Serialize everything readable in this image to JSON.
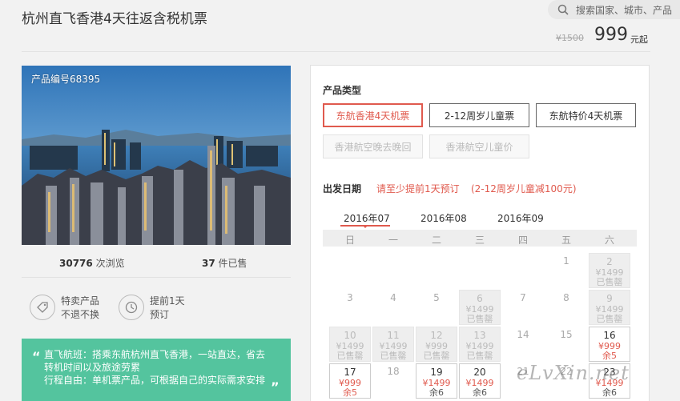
{
  "header": {
    "title": "杭州直飞香港4天往返含税机票",
    "search_placeholder": "搜索国家、城市、产品",
    "old_price": "¥1500",
    "price": "999",
    "price_unit": "元起"
  },
  "product": {
    "number_label": "产品编号68395",
    "views_count": "30776",
    "views_label": "次浏览",
    "sold_count": "37",
    "sold_label": "件已售",
    "features": [
      {
        "icon": "tag-icon",
        "line1": "特卖产品",
        "line2": "不退不换"
      },
      {
        "icon": "clock-icon",
        "line1": "提前1天",
        "line2": "预订"
      }
    ],
    "description": [
      "直飞航班：搭乘东航杭州直飞香港，一站直达，省去",
      "转机时间以及旅途劳累",
      "行程自由：单机票产品，可根据自己的实际需求安排"
    ],
    "quote_open": "“",
    "quote_close": "”"
  },
  "booking": {
    "type_label": "产品类型",
    "types": [
      {
        "label": "东航香港4天机票",
        "state": "active"
      },
      {
        "label": "2-12周岁儿童票",
        "state": "normal"
      },
      {
        "label": "东航特价4天机票",
        "state": "normal"
      },
      {
        "label": "香港航空晚去晚回",
        "state": "disabled"
      },
      {
        "label": "香港航空儿童价",
        "state": "disabled"
      }
    ],
    "date_label": "出发日期",
    "note1": "请至少提前1天预订",
    "note2": "(2-12周岁儿童减100元)",
    "months": [
      "2016年07",
      "2016年08",
      "2016年09"
    ],
    "active_month": "2016年07",
    "weekdays": [
      "日",
      "一",
      "二",
      "三",
      "四",
      "五",
      "六"
    ],
    "days": [
      {
        "n": "1",
        "col": 5,
        "row": 0,
        "state": "plain"
      },
      {
        "n": "2",
        "col": 6,
        "row": 0,
        "state": "soldout",
        "price": "¥1499",
        "status": "已售罄"
      },
      {
        "n": "3",
        "col": 0,
        "row": 1,
        "state": "plain"
      },
      {
        "n": "4",
        "col": 1,
        "row": 1,
        "state": "plain"
      },
      {
        "n": "5",
        "col": 2,
        "row": 1,
        "state": "plain"
      },
      {
        "n": "6",
        "col": 3,
        "row": 1,
        "state": "soldout",
        "price": "¥1499",
        "status": "已售罄"
      },
      {
        "n": "7",
        "col": 4,
        "row": 1,
        "state": "plain"
      },
      {
        "n": "8",
        "col": 5,
        "row": 1,
        "state": "plain"
      },
      {
        "n": "9",
        "col": 6,
        "row": 1,
        "state": "soldout",
        "price": "¥1499",
        "status": "已售罄"
      },
      {
        "n": "10",
        "col": 0,
        "row": 2,
        "state": "soldout",
        "price": "¥1499",
        "status": "已售罄"
      },
      {
        "n": "11",
        "col": 1,
        "row": 2,
        "state": "soldout",
        "price": "¥1499",
        "status": "已售罄"
      },
      {
        "n": "12",
        "col": 2,
        "row": 2,
        "state": "soldout",
        "price": "¥999",
        "status": "已售罄"
      },
      {
        "n": "13",
        "col": 3,
        "row": 2,
        "state": "soldout",
        "price": "¥1499",
        "status": "已售罄"
      },
      {
        "n": "14",
        "col": 4,
        "row": 2,
        "state": "plain"
      },
      {
        "n": "15",
        "col": 5,
        "row": 2,
        "state": "plain"
      },
      {
        "n": "16",
        "col": 6,
        "row": 2,
        "state": "avail red",
        "price": "¥999",
        "status": "余5"
      },
      {
        "n": "17",
        "col": 0,
        "row": 3,
        "state": "avail red",
        "price": "¥999",
        "status": "余5"
      },
      {
        "n": "18",
        "col": 1,
        "row": 3,
        "state": "plain"
      },
      {
        "n": "19",
        "col": 2,
        "row": 3,
        "state": "avail",
        "price": "¥1499",
        "status": "余6"
      },
      {
        "n": "20",
        "col": 3,
        "row": 3,
        "state": "avail",
        "price": "¥1499",
        "status": "余6"
      },
      {
        "n": "21",
        "col": 4,
        "row": 3,
        "state": "plain"
      },
      {
        "n": "22",
        "col": 5,
        "row": 3,
        "state": "plain"
      },
      {
        "n": "23",
        "col": 6,
        "row": 3,
        "state": "avail",
        "price": "¥1499",
        "status": "余6"
      }
    ]
  },
  "watermark": "eLvXin.net",
  "colors": {
    "accent": "#e05a4e",
    "desc_bg": "#54c49e"
  }
}
